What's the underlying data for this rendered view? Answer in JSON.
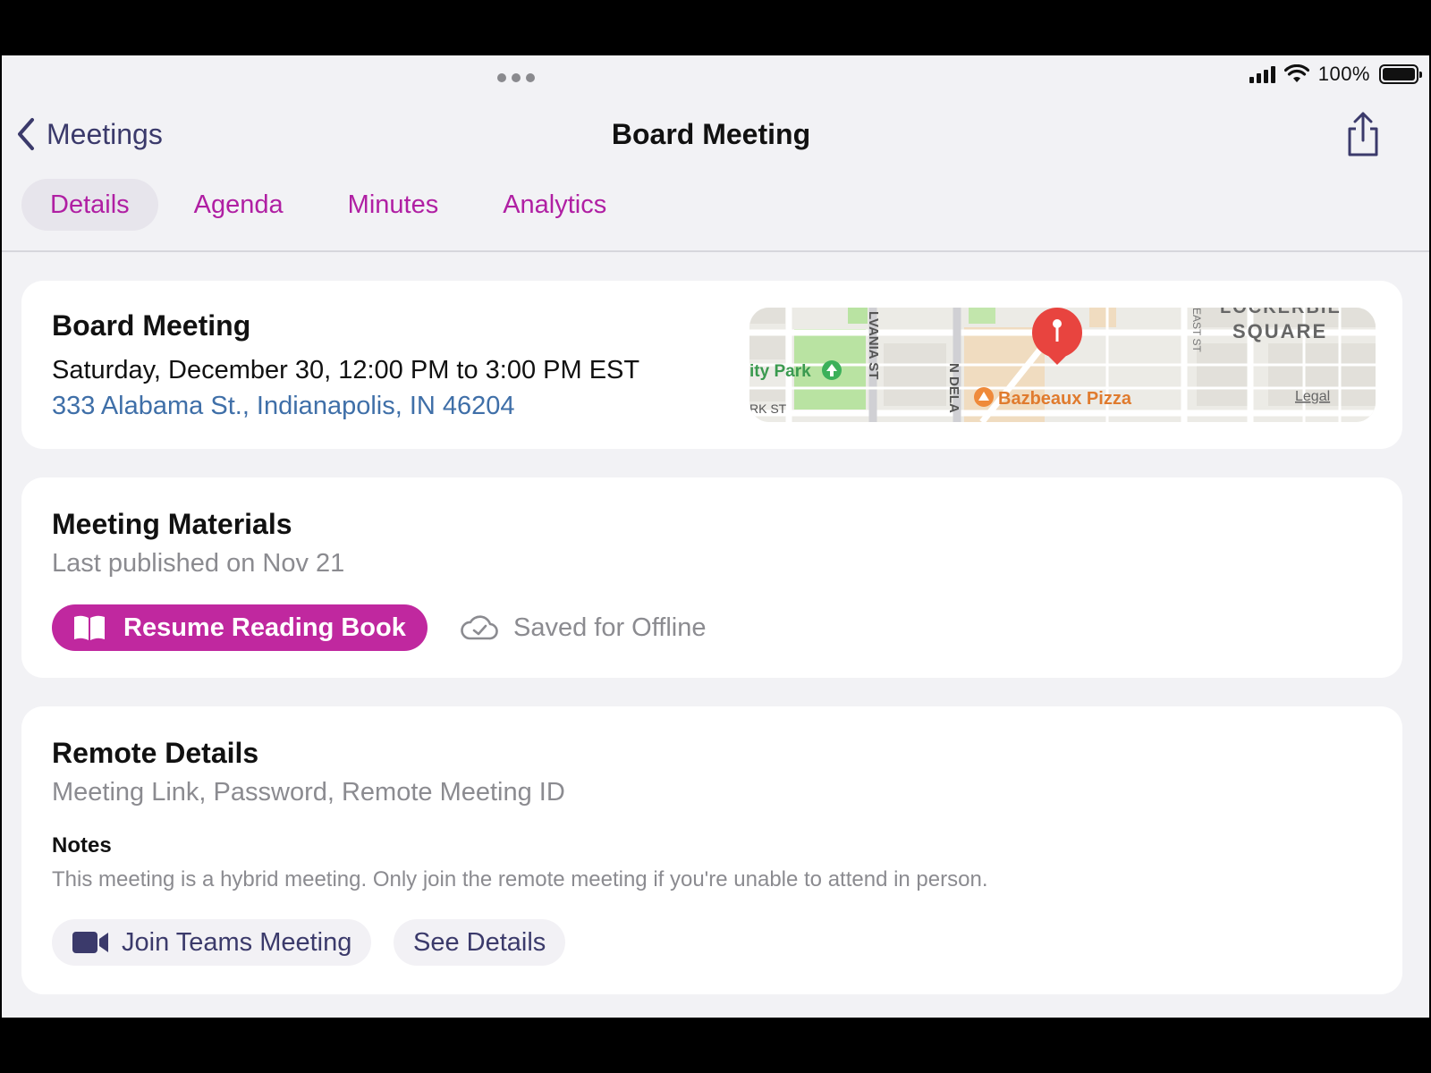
{
  "status_bar": {
    "battery": "100%"
  },
  "nav": {
    "back_label": "Meetings",
    "title": "Board Meeting"
  },
  "tabs": [
    {
      "label": "Details",
      "active": true
    },
    {
      "label": "Agenda"
    },
    {
      "label": "Minutes"
    },
    {
      "label": "Analytics"
    }
  ],
  "meeting": {
    "title": "Board Meeting",
    "when": "Saturday, December 30, 12:00 PM to 3:00 PM EST",
    "address": "333 Alabama St., Indianapolis, IN 46204",
    "map": {
      "labels": {
        "park": "ity Park",
        "street1": "LVANIA ST",
        "street2": "N DELA",
        "street3": "EAST ST",
        "street4": "RK ST",
        "square_top": "LOCKERBIE",
        "square": "SQUARE",
        "poi": "Bazbeaux Pizza",
        "legal": "Legal"
      }
    }
  },
  "materials": {
    "title": "Meeting Materials",
    "subtitle": "Last published on Nov 21",
    "resume_button": "Resume Reading Book",
    "offline_status": "Saved for Offline"
  },
  "remote": {
    "title": "Remote Details",
    "subtitle": "Meeting Link, Password, Remote Meeting ID",
    "notes_label": "Notes",
    "notes_text": "This meeting is a hybrid meeting. Only join the remote meeting if you're unable to attend in person.",
    "join_button": "Join Teams Meeting",
    "details_button": "See Details"
  },
  "colors": {
    "accent": "#c0289f",
    "tab_text": "#b01fa3",
    "link": "#3f6fa8",
    "pin": "#e8443f"
  }
}
